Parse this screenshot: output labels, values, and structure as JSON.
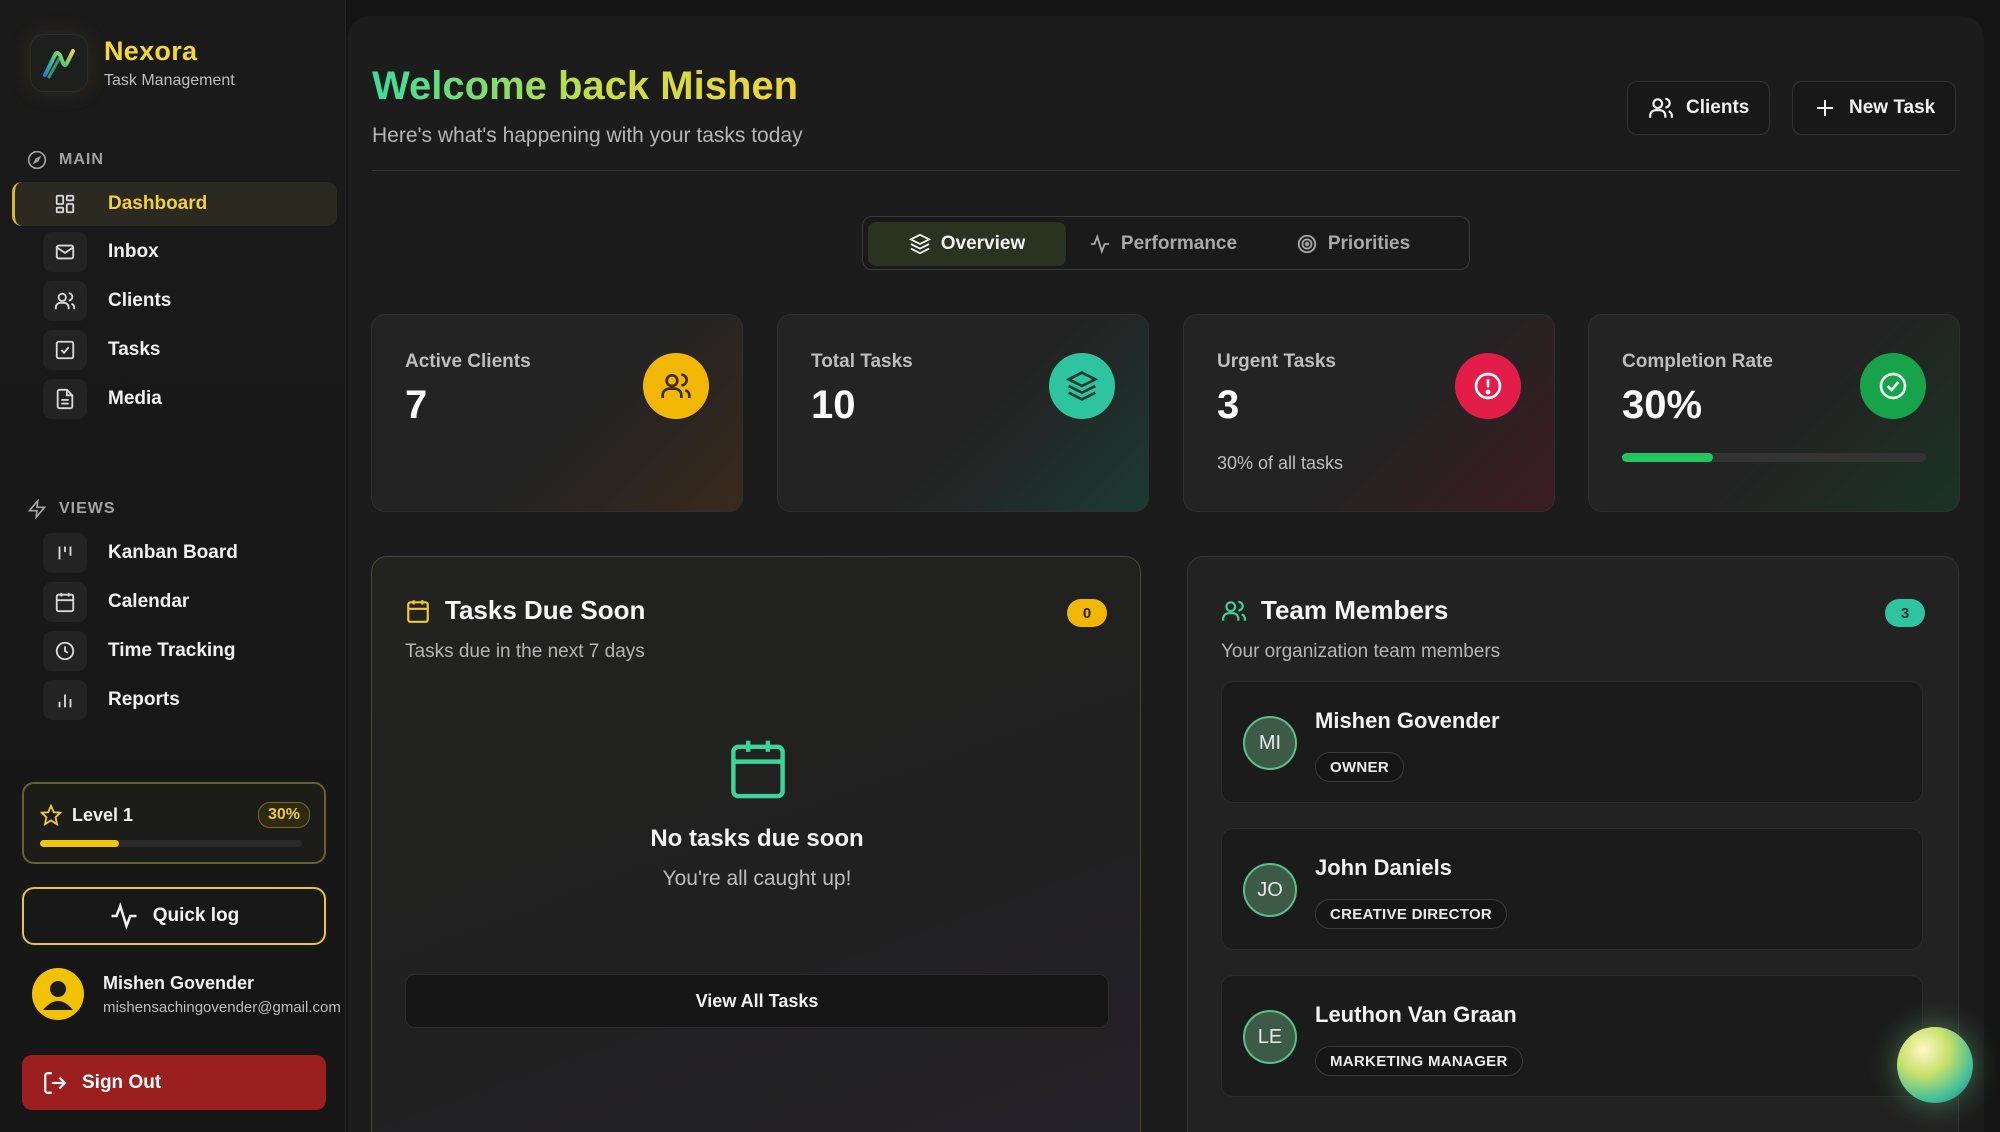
{
  "brand": {
    "name": "Nexora",
    "subtitle": "Task Management"
  },
  "sidebar": {
    "main_label": "MAIN",
    "views_label": "VIEWS",
    "main_items": [
      {
        "label": "Dashboard",
        "icon": "grid-icon",
        "active": true
      },
      {
        "label": "Inbox",
        "icon": "mail-icon"
      },
      {
        "label": "Clients",
        "icon": "users-icon"
      },
      {
        "label": "Tasks",
        "icon": "checkbox-icon"
      },
      {
        "label": "Media",
        "icon": "file-icon"
      }
    ],
    "view_items": [
      {
        "label": "Kanban Board",
        "icon": "kanban-icon"
      },
      {
        "label": "Calendar",
        "icon": "calendar-icon"
      },
      {
        "label": "Time Tracking",
        "icon": "clock-icon"
      },
      {
        "label": "Reports",
        "icon": "bar-chart-icon"
      }
    ],
    "level": {
      "label": "Level 1",
      "percent_text": "30%",
      "progress": 0.3
    },
    "quick_log": "Quick log",
    "user": {
      "name": "Mishen Govender",
      "email": "mishensachingovender@gmail.com"
    },
    "sign_out": "Sign Out"
  },
  "header": {
    "title": "Welcome back Mishen",
    "subtitle": "Here's what's happening with your tasks today",
    "clients_button": "Clients",
    "new_task_button": "New Task"
  },
  "tabs": [
    {
      "label": "Overview",
      "icon": "layers-icon",
      "active": true
    },
    {
      "label": "Performance",
      "icon": "pulse-icon"
    },
    {
      "label": "Priorities",
      "icon": "target-icon"
    }
  ],
  "stats": {
    "active_clients": {
      "label": "Active Clients",
      "value": "7",
      "icon": "users-icon",
      "color": "#f2b705"
    },
    "total_tasks": {
      "label": "Total Tasks",
      "value": "10",
      "icon": "layers-icon",
      "color": "#2ec4a0"
    },
    "urgent_tasks": {
      "label": "Urgent Tasks",
      "value": "3",
      "note": "30% of all tasks",
      "icon": "alert-icon",
      "color": "#e11d48"
    },
    "completion_rate": {
      "label": "Completion Rate",
      "value": "30%",
      "progress": 0.3,
      "icon": "check-circle-icon",
      "color": "#16a34a"
    }
  },
  "tasks_due": {
    "title": "Tasks Due Soon",
    "subtitle": "Tasks due in the next 7 days",
    "count": "0",
    "empty_title": "No tasks due soon",
    "empty_subtitle": "You're all caught up!",
    "view_all": "View All Tasks"
  },
  "team": {
    "title": "Team Members",
    "subtitle": "Your organization team members",
    "count": "3",
    "members": [
      {
        "initials": "MI",
        "name": "Mishen Govender",
        "role": "OWNER"
      },
      {
        "initials": "JO",
        "name": "John Daniels",
        "role": "CREATIVE DIRECTOR"
      },
      {
        "initials": "LE",
        "name": "Leuthon Van Graan",
        "role": "MARKETING MANAGER"
      }
    ]
  }
}
